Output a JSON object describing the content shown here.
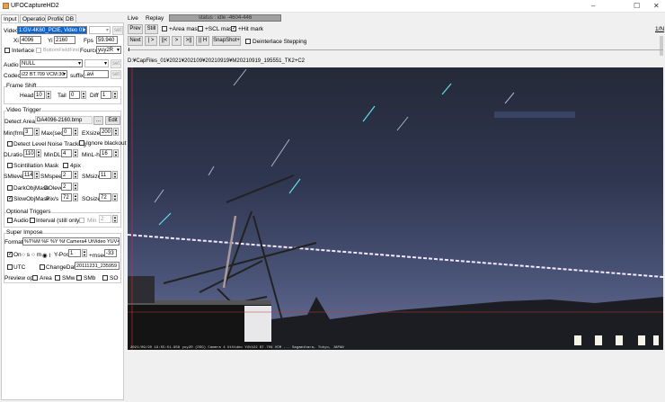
{
  "window": {
    "title": "UFOCaptureHD2",
    "minimize": "–",
    "maximize": "☐",
    "close": "✕"
  },
  "left_tabs": [
    "Input",
    "Operation",
    "Profile",
    "DB"
  ],
  "input": {
    "video_label": "Video",
    "video_value": "1:GV-4K60_PCIE, Video 01 Ca",
    "set": "set",
    "xi_label": "Xi",
    "xi": "4096",
    "yi_label": "Yi",
    "yi": "2160",
    "fps_label": "Fps",
    "fps": "59.940",
    "interlace": "Interlace",
    "bottom_field_first": "BottomFieldFirst",
    "fourcc_label": "Fourcc",
    "fourcc": "yuy2R",
    "audio_label": "Audio",
    "audio": "NULL",
    "codec_label": "Codec",
    "codec": "i22 BT.709 VCM:30",
    "suffix_label": "suffix",
    "suffix": ".avi",
    "frame_shift": {
      "title": "Frame Shift",
      "head_label": "Head",
      "head": "10",
      "tail_label": "Tail",
      "tail": "0",
      "diff_label": "Diff",
      "diff": "1"
    }
  },
  "video_trigger": {
    "title": "Video Trigger",
    "detect_area_label": "Detect Area",
    "detect_area": "DA4096-2160.bmp",
    "browse": "...",
    "edit": "Edit",
    "min_label": "Min(frm)",
    "min": "3",
    "max_label": "Max(sec)",
    "max": "0",
    "exsize_label": "EXsize",
    "exsize": "200",
    "detect_noise": "Detect Level Noise Tracking",
    "ignore_blackout": "Ignore blackout",
    "dlratio_label": "DLratio",
    "dlratio": "110",
    "mindl_label": "MinDL",
    "mindl": "4",
    "minlh_label": "MinL-h",
    "minlh": "16",
    "scint_mask": "Scintillation Mask",
    "fourpix": "4pix",
    "smlevel_label": "SMlevel",
    "smlevel": "114",
    "smspeed_label": "SMspeed",
    "smspeed": "2",
    "smsize_label": "SMsize",
    "smsize": "11",
    "darkobj": "DarkObjMask",
    "dolevel_label": "DOlevel",
    "dolevel": "2",
    "slowobj": "SlowObjMask",
    "pixs_label": "Pix/s",
    "pixs": "72",
    "sosize_label": "SOsize",
    "sosize": "72"
  },
  "optional_triggers": {
    "title": "Optional Triggers",
    "audio": "Audio",
    "interval": "Interval (still only",
    "min_label": "Min",
    "min": "2"
  },
  "super_impose": {
    "title": "Super Impose",
    "format_label": "Format",
    "format": "%T%M %F %Y %f  Camera4  UtVideo YUV4",
    "on": "On",
    "s": "s",
    "m": "m",
    "l": "l",
    "ypos_label": "Y-Pos",
    "ypos": "1",
    "msec_label": "+msec",
    "msec": "-33",
    "utc": "UTC",
    "change_date": "ChangeDate",
    "date": "20111231_235959",
    "preview_label": "Preview opt",
    "area": "Area",
    "smw": "SMw",
    "smb": "SMb",
    "so": "SO"
  },
  "main": {
    "tabs": [
      "Live",
      "Replay"
    ],
    "status": "status : idle  -4604-446",
    "prev": "Prev",
    "still": "Still",
    "area_mask": "+Area mask",
    "scl_mask": "+SCL mask",
    "hit_mark": "+Hit mark",
    "next": "Next",
    "play": "| >",
    "first": "||<",
    "step": ">",
    "last": ">||",
    "pause": "|| H",
    "snapshot": "SnapShot+",
    "deinterlace": "Deinterlace Stepping",
    "path": "D:¥CapFiles_01¥2021¥202109¥20210919¥M20210919_195551_TK2+C2",
    "frame_count": "1/N",
    "overlay": "2021/09/20 19:55:51.958   yuy2R (DSG)  Camera 4  UtVideo YUV422 BT.709 VCM  ...  Sagamihara, Tokyo, JAPAN"
  }
}
